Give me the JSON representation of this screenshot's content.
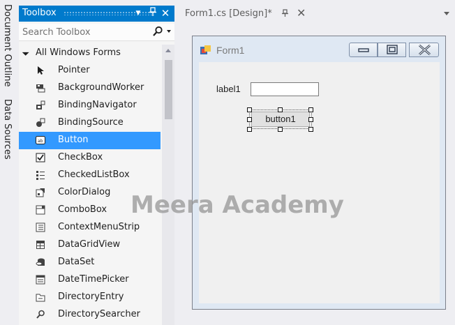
{
  "side_tabs": [
    "Document Outline",
    "Data Sources"
  ],
  "toolbox": {
    "title": "Toolbox",
    "search_placeholder": "Search Toolbox",
    "group": "All Windows Forms",
    "selected_item": "Button",
    "items": [
      {
        "label": "Pointer",
        "icon": "pointer-icon"
      },
      {
        "label": "BackgroundWorker",
        "icon": "background-worker-icon"
      },
      {
        "label": "BindingNavigator",
        "icon": "binding-navigator-icon"
      },
      {
        "label": "BindingSource",
        "icon": "binding-source-icon"
      },
      {
        "label": "Button",
        "icon": "button-icon"
      },
      {
        "label": "CheckBox",
        "icon": "checkbox-icon"
      },
      {
        "label": "CheckedListBox",
        "icon": "checked-list-box-icon"
      },
      {
        "label": "ColorDialog",
        "icon": "color-dialog-icon"
      },
      {
        "label": "ComboBox",
        "icon": "combo-box-icon"
      },
      {
        "label": "ContextMenuStrip",
        "icon": "context-menu-strip-icon"
      },
      {
        "label": "DataGridView",
        "icon": "data-grid-view-icon"
      },
      {
        "label": "DataSet",
        "icon": "dataset-icon"
      },
      {
        "label": "DateTimePicker",
        "icon": "date-time-picker-icon"
      },
      {
        "label": "DirectoryEntry",
        "icon": "directory-entry-icon"
      },
      {
        "label": "DirectorySearcher",
        "icon": "directory-searcher-icon"
      }
    ]
  },
  "document_tab": {
    "title": "Form1.cs [Design]*"
  },
  "form": {
    "title": "Form1",
    "label_text": "label1",
    "button_text": "button1",
    "textbox_value": ""
  },
  "watermark": "Meera Academy",
  "colors": {
    "accent": "#007acc",
    "selection": "#3399ff",
    "ide_background": "#eeeef2"
  }
}
